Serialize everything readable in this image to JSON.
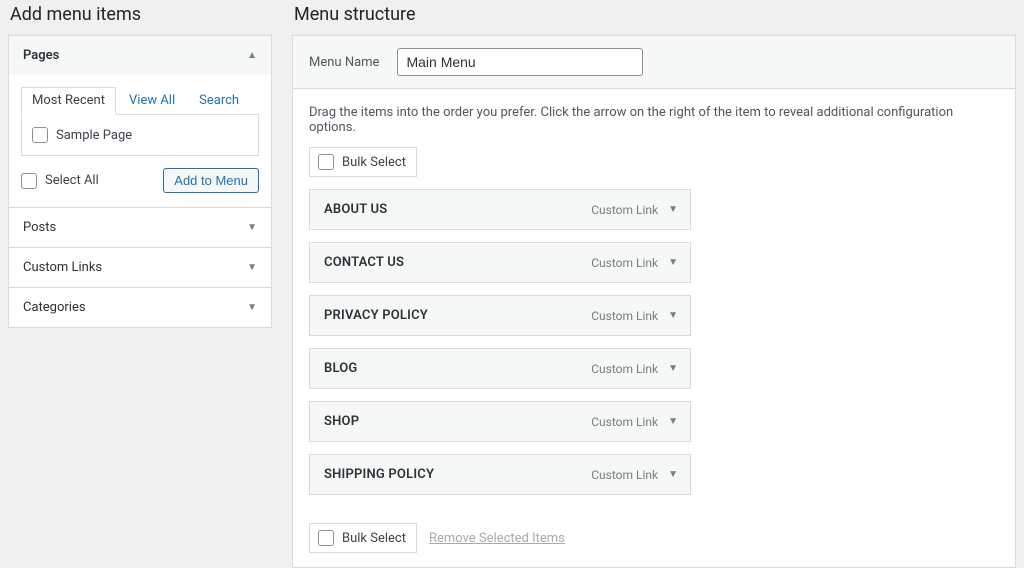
{
  "left": {
    "title": "Add menu items",
    "sections": {
      "pages": {
        "label": "Pages",
        "tabs": {
          "recent": "Most Recent",
          "view_all": "View All",
          "search": "Search"
        },
        "page_item": "Sample Page",
        "select_all": "Select All",
        "add_button": "Add to Menu"
      },
      "posts": "Posts",
      "custom_links": "Custom Links",
      "categories": "Categories"
    }
  },
  "right": {
    "title": "Menu structure",
    "menu_name_label": "Menu Name",
    "menu_name_value": "Main Menu",
    "instructions": "Drag the items into the order you prefer. Click the arrow on the right of the item to reveal additional configuration options.",
    "bulk_select": "Bulk Select",
    "type_label": "Custom Link",
    "remove_selected": "Remove Selected Items",
    "items": [
      {
        "label": "ABOUT US"
      },
      {
        "label": "CONTACT US"
      },
      {
        "label": "PRIVACY POLICY"
      },
      {
        "label": "BLOG"
      },
      {
        "label": "SHOP"
      },
      {
        "label": "SHIPPING POLICY"
      }
    ]
  }
}
